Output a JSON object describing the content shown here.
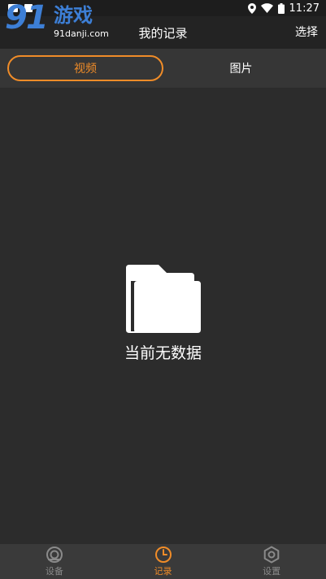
{
  "status_bar": {
    "time": "11:27"
  },
  "watermark": {
    "number": "91",
    "text": "游戏",
    "url": "91danji.com"
  },
  "header": {
    "title": "我的记录",
    "action_label": "选择"
  },
  "tabs": [
    {
      "label": "视频",
      "selected": true
    },
    {
      "label": "图片",
      "selected": false
    }
  ],
  "empty_state": {
    "message": "当前无数据",
    "icon": "folder-icon"
  },
  "bottom_nav": [
    {
      "label": "设备",
      "icon": "camera-icon",
      "active": false
    },
    {
      "label": "记录",
      "icon": "clock-icon",
      "active": true
    },
    {
      "label": "设置",
      "icon": "settings-gear-icon",
      "active": false
    }
  ],
  "colors": {
    "accent": "#f08c28",
    "background": "#2c2c2c",
    "header": "#232323",
    "tab_bar": "#363636",
    "bottom_nav": "#3a3a3a",
    "inactive": "#8a8a8a"
  }
}
